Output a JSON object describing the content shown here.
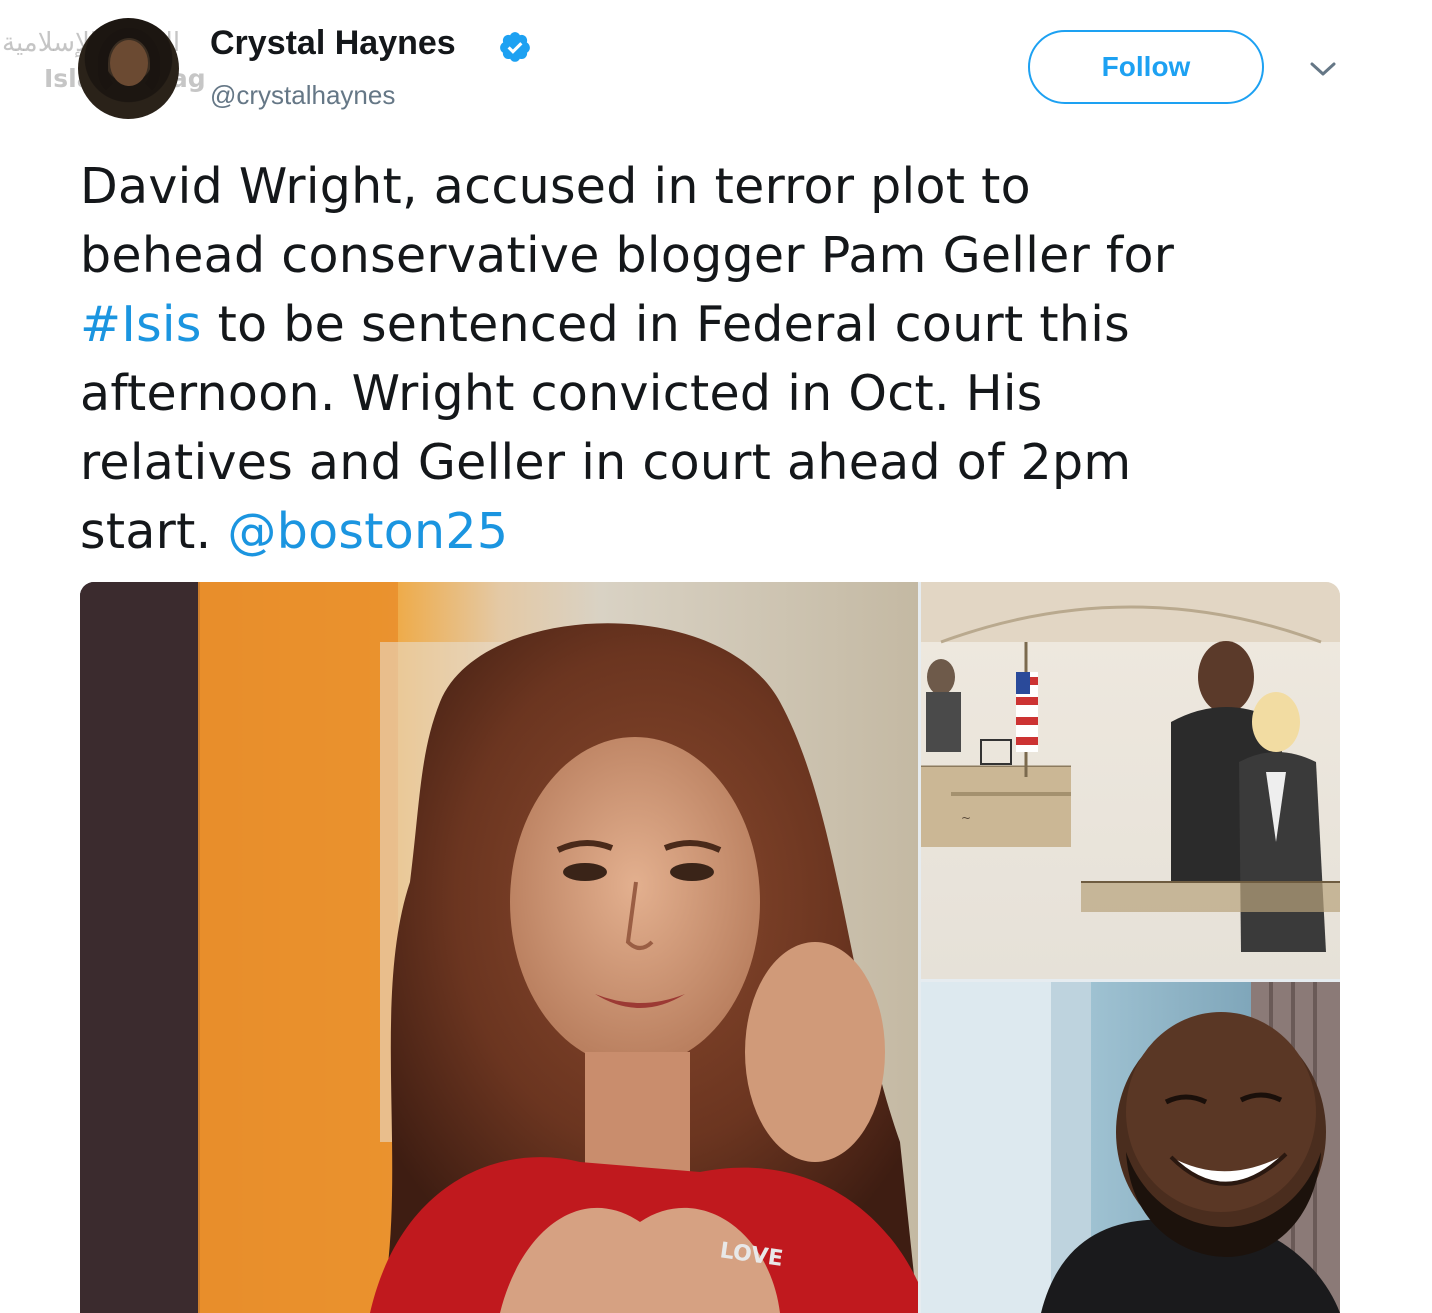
{
  "watermark": {
    "arabic": "الحقيبة الإسلامية",
    "latin": "Islamic Bag"
  },
  "tweet": {
    "author": {
      "display_name": "Crystal Haynes",
      "handle": "@crystalhaynes",
      "verified": true
    },
    "follow_label": "Follow",
    "text_lines": [
      [
        {
          "t": "David Wright, accused in terror plot to"
        }
      ],
      [
        {
          "t": "behead conservative blogger Pam Geller for"
        }
      ],
      [
        {
          "t": "#Isis",
          "link": true
        },
        {
          "t": " to be sentenced in Federal court this"
        }
      ],
      [
        {
          "t": "afternoon. Wright convicted in Oct. His"
        }
      ],
      [
        {
          "t": "relatives and Geller in court ahead of 2pm"
        }
      ],
      [
        {
          "t": "start. "
        },
        {
          "t": "@boston25",
          "link": true
        }
      ]
    ],
    "media": [
      {
        "name": "photo-woman-portrait",
        "necklace_text": "LOVE"
      },
      {
        "name": "photo-courtroom-sketch"
      },
      {
        "name": "photo-smiling-man"
      }
    ]
  },
  "colors": {
    "link": "#1b95e0",
    "follow_accent": "#1da1f2",
    "text": "#14171a",
    "secondary": "#657786"
  }
}
